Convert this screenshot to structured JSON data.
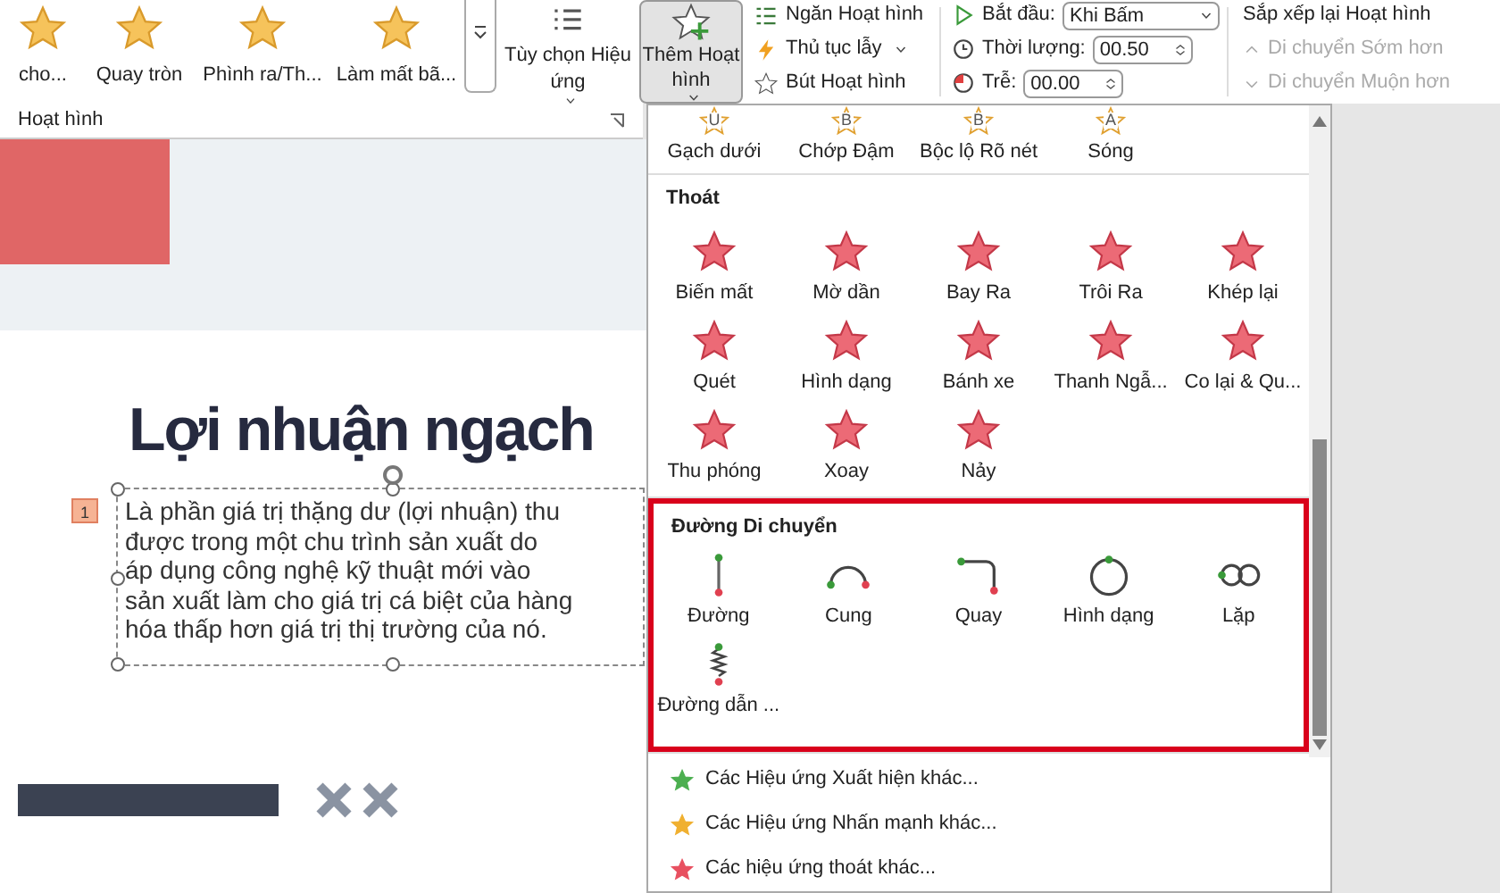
{
  "ribbon": {
    "gallery": [
      {
        "label": "cho..."
      },
      {
        "label": "Quay tròn"
      },
      {
        "label": "Phình ra/Th..."
      },
      {
        "label": "Làm mất bã..."
      }
    ],
    "effect_options": "Tùy chọn Hiệu ứng",
    "add_animation": "Thêm Hoạt hình",
    "group_label": "Hoạt hình",
    "advanced": [
      {
        "kind": "pane",
        "label": "Ngăn Hoạt hình"
      },
      {
        "kind": "trigger",
        "label": "Thủ tục lẫy"
      },
      {
        "kind": "painter",
        "label": "Bút Hoạt hình"
      }
    ],
    "timing": {
      "start_label": "Bắt đầu:",
      "start_value": "Khi Bấm",
      "duration_label": "Thời lượng:",
      "duration_value": "00.50",
      "delay_label": "Trễ:",
      "delay_value": "00.00"
    },
    "reorder": {
      "title": "Sắp xếp lại Hoạt hình",
      "items": [
        {
          "kind": "up",
          "label": "Di chuyển Sớm hơn",
          "disabled": true
        },
        {
          "kind": "down",
          "label": "Di chuyển Muộn hơn",
          "disabled": true
        }
      ]
    }
  },
  "slide": {
    "title": "Lợi nhuận ngạch",
    "animation_tag": "1",
    "body": "Là phần giá trị thặng dư (lợi nhuận) thu\nđược trong một chu trình sản xuất do\náp dụng công nghệ kỹ thuật mới vào\nsản xuất làm cho giá trị cá biệt của hàng\nhóa thấp hơn giá trị thị trường của nó."
  },
  "menu": {
    "sections": [
      {
        "kind": "emphasis",
        "highlighted": false,
        "items": [
          {
            "glyph": "U",
            "label": "Gạch dưới"
          },
          {
            "glyph": "B",
            "label": "Chớp Đậm"
          },
          {
            "glyph": "B",
            "label": "Bộc lộ Rõ nét"
          },
          {
            "glyph": "A",
            "label": "Sóng"
          }
        ]
      },
      {
        "kind": "exit",
        "title": "Thoát",
        "highlighted": false,
        "items": [
          {
            "label": "Biến mất"
          },
          {
            "label": "Mờ dần"
          },
          {
            "label": "Bay Ra"
          },
          {
            "label": "Trôi Ra"
          },
          {
            "label": "Khép lại"
          },
          {
            "label": "Quét"
          },
          {
            "label": "Hình dạng"
          },
          {
            "label": "Bánh xe"
          },
          {
            "label": "Thanh Ngẫ..."
          },
          {
            "label": "Co lại & Qu..."
          },
          {
            "label": "Thu phóng"
          },
          {
            "label": "Xoay"
          },
          {
            "label": "Nảy"
          }
        ]
      },
      {
        "kind": "motion",
        "title": "Đường Di chuyển",
        "highlighted": true,
        "items": [
          {
            "kind": "line",
            "label": "Đường"
          },
          {
            "kind": "arc",
            "label": "Cung"
          },
          {
            "kind": "turn",
            "label": "Quay"
          },
          {
            "kind": "shape",
            "label": "Hình dạng"
          },
          {
            "kind": "loop",
            "label": "Lặp"
          },
          {
            "kind": "custom",
            "label": "Đường dẫn ..."
          }
        ]
      }
    ],
    "more": [
      {
        "kind": "entrance",
        "label": "Các Hiệu ứng Xuất hiện khác..."
      },
      {
        "kind": "emphasis",
        "label": "Các Hiệu ứng Nhấn mạnh khác..."
      },
      {
        "kind": "exit",
        "label": "Các hiệu ứng thoát khác..."
      }
    ]
  }
}
